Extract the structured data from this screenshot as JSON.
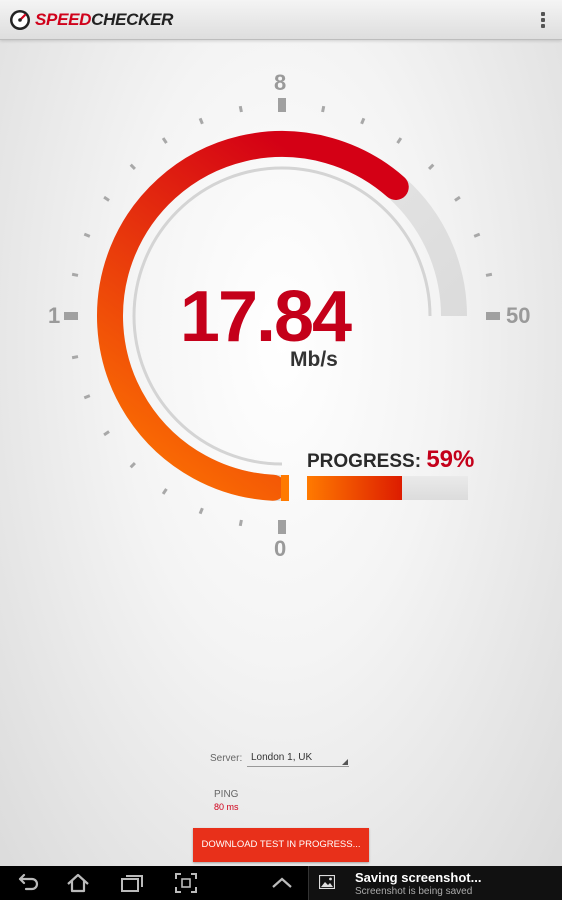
{
  "app": {
    "logo_speed": "SPEED",
    "logo_checker": "CHECKER"
  },
  "gauge": {
    "ticks": {
      "top": "8",
      "left": "1",
      "right": "50",
      "bottom": "0"
    },
    "speed": "17.84",
    "unit": "Mb/s",
    "fill_fraction": 0.82,
    "colors": {
      "arc_start": "#ff7a00",
      "arc_end": "#d40015",
      "value": "#c4001a"
    }
  },
  "progress": {
    "label": "PROGRESS:",
    "percent_text": "59%",
    "fill_percent": 59
  },
  "server": {
    "label": "Server:",
    "selected": "London 1, UK"
  },
  "ping": {
    "label": "PING",
    "value": "80 ms"
  },
  "download_button": {
    "label": "DOWNLOAD TEST IN PROGRESS..."
  },
  "notification": {
    "title": "Saving screenshot...",
    "subtitle": "Screenshot is being saved",
    "icon": "image-icon"
  },
  "nav": {
    "icons": [
      "back-icon",
      "home-icon",
      "recent-apps-icon",
      "screenshot-icon",
      "chevron-up-icon"
    ]
  }
}
